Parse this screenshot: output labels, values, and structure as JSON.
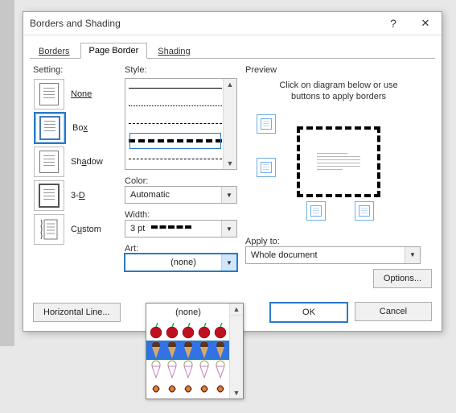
{
  "dialog": {
    "title": "Borders and Shading"
  },
  "tabs": {
    "borders": "Borders",
    "page_border": "Page Border",
    "shading": "Shading",
    "active": "page_border"
  },
  "setting": {
    "label": "Setting:",
    "items": [
      {
        "label": "None",
        "key": "none"
      },
      {
        "label": "Box",
        "key": "box"
      },
      {
        "label": "Shadow",
        "key": "shadow"
      },
      {
        "label": "3-D",
        "key": "3d"
      },
      {
        "label": "Custom",
        "key": "custom"
      }
    ],
    "selected": "box"
  },
  "style": {
    "label": "Style:",
    "color_label": "Color:",
    "color_value": "Automatic",
    "width_label": "Width:",
    "width_value": "3 pt",
    "art_label": "Art:",
    "art_value": "(none)",
    "art_options": [
      {
        "value": "(none)"
      },
      {
        "value": "apples-art"
      },
      {
        "value": "icecream-dark-art"
      },
      {
        "value": "icecream-light-art"
      },
      {
        "value": "candy-art"
      }
    ]
  },
  "preview": {
    "label": "Preview",
    "caption_line1": "Click on diagram below or use",
    "caption_line2": "buttons to apply borders"
  },
  "apply": {
    "label": "Apply to:",
    "value": "Whole document"
  },
  "buttons": {
    "options": "Options...",
    "hline": "Horizontal Line...",
    "ok": "OK",
    "cancel": "Cancel"
  }
}
